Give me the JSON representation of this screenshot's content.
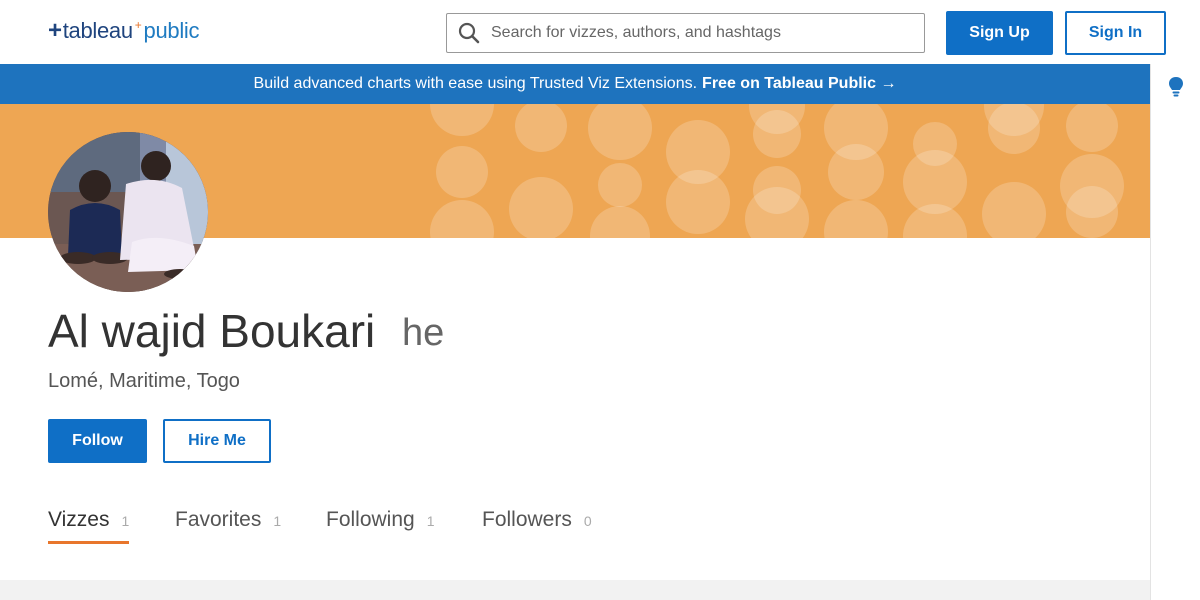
{
  "header": {
    "logo": {
      "plus": "+",
      "word1": "tableau",
      "spark": "+",
      "word2": "public"
    },
    "search": {
      "placeholder": "Search for vizzes, authors, and hashtags",
      "icon": "search-icon"
    },
    "signup_label": "Sign Up",
    "signin_label": "Sign In"
  },
  "announcement": {
    "text": "Build advanced charts with ease using Trusted Viz Extensions.",
    "cta": "Free on Tableau Public →"
  },
  "rightrail": {
    "icon": "lightbulb-icon"
  },
  "colors": {
    "primary": "#0f6fc6",
    "banner": "#1e73be",
    "cover": "#eea653",
    "active_tab": "#e8762c"
  },
  "profile": {
    "name": "Al wajid Boukari",
    "pronoun": "he",
    "location": "Lomé, Maritime, Togo",
    "follow_label": "Follow",
    "hire_label": "Hire Me"
  },
  "tabs": [
    {
      "label": "Vizzes",
      "count": "1",
      "active": true
    },
    {
      "label": "Favorites",
      "count": "1",
      "active": false
    },
    {
      "label": "Following",
      "count": "1",
      "active": false
    },
    {
      "label": "Followers",
      "count": "0",
      "active": false
    }
  ]
}
